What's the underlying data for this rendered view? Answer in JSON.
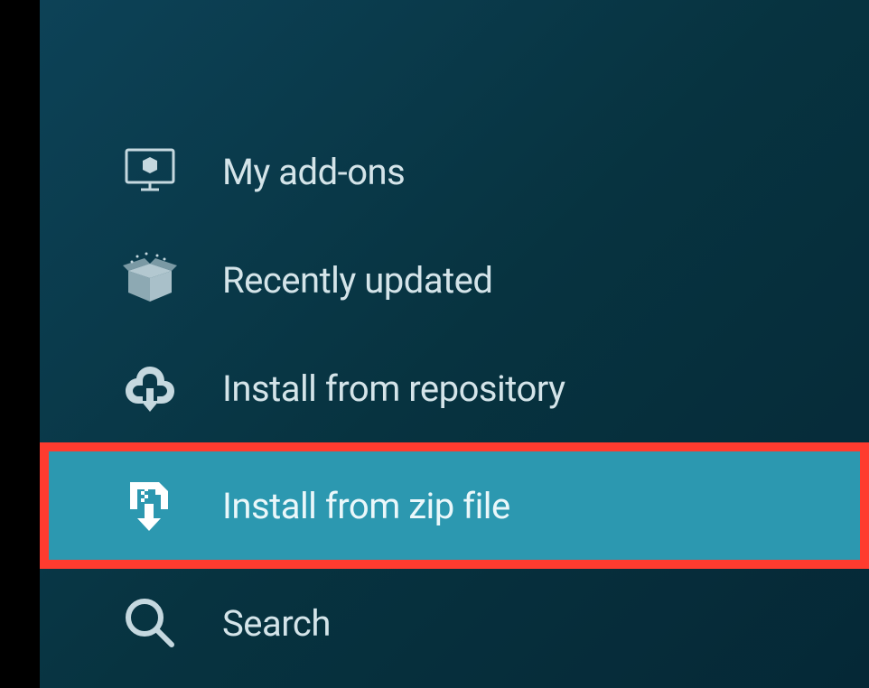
{
  "menu": {
    "items": [
      {
        "label": "My add-ons",
        "icon": "monitor-box-icon",
        "highlighted": false
      },
      {
        "label": "Recently updated",
        "icon": "open-box-icon",
        "highlighted": false
      },
      {
        "label": "Install from repository",
        "icon": "cloud-download-icon",
        "highlighted": false
      },
      {
        "label": "Install from zip file",
        "icon": "zip-download-icon",
        "highlighted": true
      },
      {
        "label": "Search",
        "icon": "search-icon",
        "highlighted": false
      }
    ]
  }
}
